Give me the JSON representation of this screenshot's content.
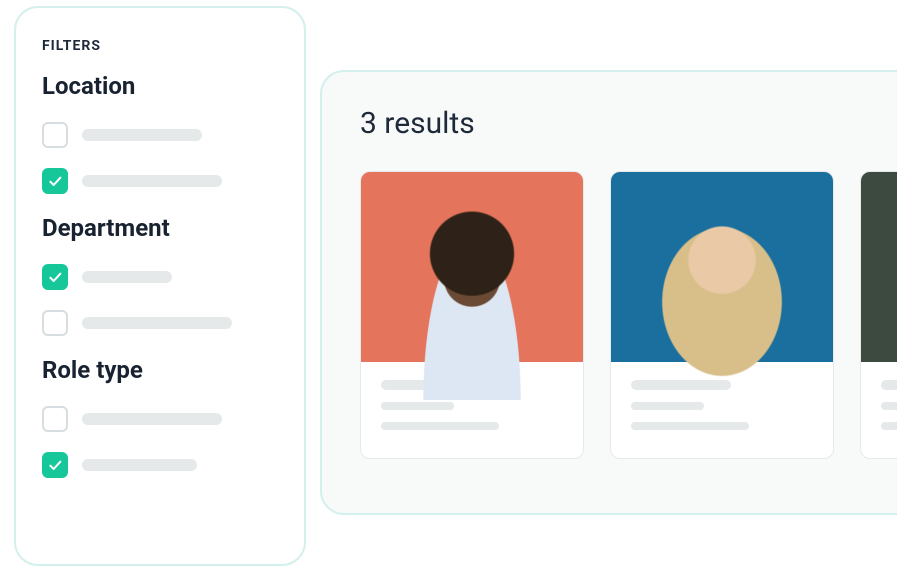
{
  "filters": {
    "heading": "FILTERS",
    "groups": [
      {
        "title": "Location",
        "options": [
          {
            "checked": false
          },
          {
            "checked": true
          }
        ]
      },
      {
        "title": "Department",
        "options": [
          {
            "checked": true
          },
          {
            "checked": false
          }
        ]
      },
      {
        "title": "Role type",
        "options": [
          {
            "checked": false
          },
          {
            "checked": true
          }
        ]
      }
    ]
  },
  "results": {
    "title": "3 results",
    "count": 3
  }
}
